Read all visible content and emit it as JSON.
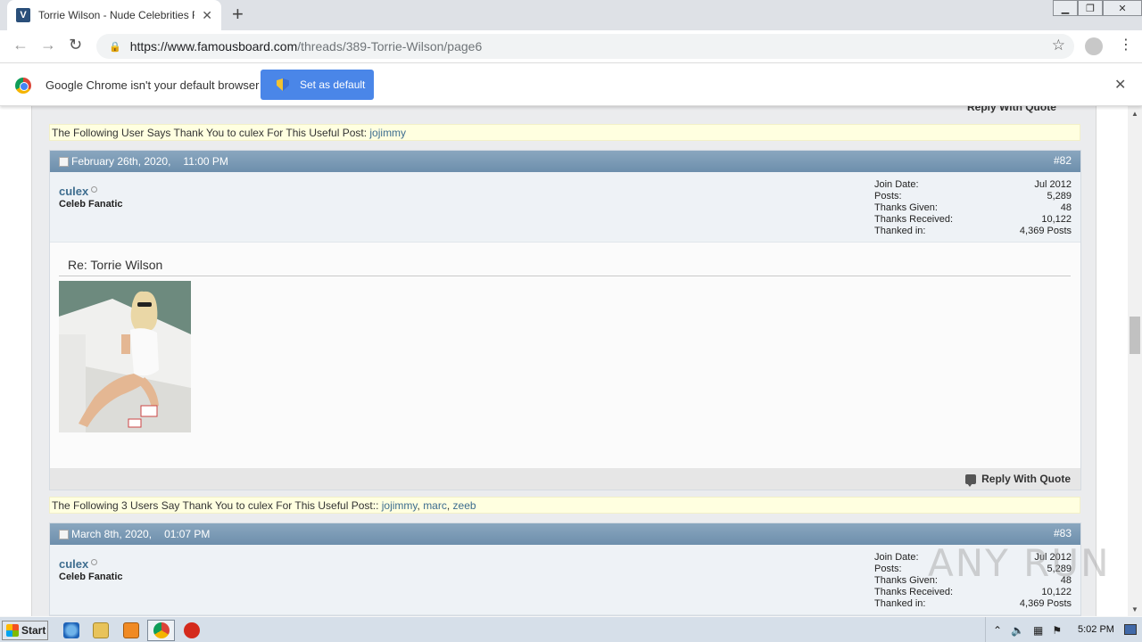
{
  "browser": {
    "tab_title": "Torrie Wilson - Nude Celebrities Forum",
    "favicon_letter": "V",
    "url_scheme": "https://www.",
    "url_host": "famousboard.com",
    "url_path": "/threads/389-Torrie-Wilson/page6",
    "icons": {
      "back": "back-arrow-icon",
      "forward": "forward-arrow-icon",
      "reload": "reload-icon",
      "lock": "lock-icon",
      "bookmark": "star-icon",
      "menu": "kebab-menu-icon"
    }
  },
  "infobar": {
    "message": "Google Chrome isn't your default browser",
    "button_label": "Set as default",
    "button_color": "#4a86e8"
  },
  "page": {
    "top_reply_label": "Reply With Quote",
    "thanks_1": {
      "text": "The Following User Says Thank You to culex For This Useful Post: ",
      "users": [
        "jojimmy"
      ]
    },
    "post_82": {
      "date": "February 26th, 2020,",
      "time": "11:00 PM",
      "number": "#82",
      "username": "culex",
      "user_title": "Celeb Fanatic",
      "stats": [
        {
          "label": "Join Date:",
          "value": "Jul 2012"
        },
        {
          "label": "Posts:",
          "value": "5,289"
        },
        {
          "label": "Thanks Given:",
          "value": "48"
        },
        {
          "label": "Thanks Received:",
          "value": "10,122"
        },
        {
          "label": "Thanked in:",
          "value": "4,369 Posts"
        }
      ],
      "title": "Re: Torrie Wilson",
      "reply_label": "Reply With Quote"
    },
    "thanks_2": {
      "text": "The Following 3 Users Say Thank You to culex For This Useful Post:: ",
      "users": [
        "jojimmy",
        "marc",
        "zeeb"
      ],
      "sep": ", "
    },
    "post_83": {
      "date": "March 8th, 2020,",
      "time": "01:07 PM",
      "number": "#83",
      "username": "culex",
      "user_title": "Celeb Fanatic",
      "stats": [
        {
          "label": "Join Date:",
          "value": "Jul 2012"
        },
        {
          "label": "Posts:",
          "value": "5,289"
        },
        {
          "label": "Thanks Given:",
          "value": "48"
        },
        {
          "label": "Thanks Received:",
          "value": "10,122"
        },
        {
          "label": "Thanked in:",
          "value": "4,369 Posts"
        }
      ]
    },
    "colors": {
      "post_header": "#6d8fac",
      "link": "#3e6d8f",
      "thanks_bg": "#ffffe0"
    }
  },
  "watermark": "ANY RUN",
  "taskbar": {
    "start_label": "Start",
    "clock": "5:02 PM"
  }
}
